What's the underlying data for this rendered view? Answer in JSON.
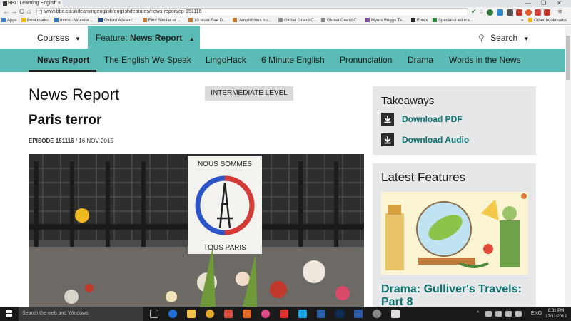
{
  "browser": {
    "tab_title": "BBC Learning English",
    "tab_close": "×",
    "url": "www.bbc.co.uk/learningenglish/english/features/news-report/ep-151116",
    "win_controls": [
      "—",
      "❐",
      "✕"
    ],
    "nav": {
      "back": "←",
      "forward": "→",
      "reload": "C",
      "home": "⌂"
    },
    "star": "☆",
    "menu": "≡",
    "bookmarks": [
      "Apps",
      "Bookmarks",
      "Inbox - Wunder...",
      "Oxford Advanc...",
      "Find Similar or ...",
      "10 Must-See D...",
      "'Amphibious ho...",
      "Global Grand C...",
      "Global Grand C...",
      "Myers Briggs Te...",
      "Forex",
      "Specialist educa...",
      "»",
      "Other bookmarks"
    ]
  },
  "site": {
    "courses_label": "Courses",
    "courses_caret": "▼",
    "feature_prefix": "Feature: ",
    "feature_name": "News Report",
    "feature_caret": "▲",
    "search_icon": "⚲",
    "search_label": "Search",
    "search_caret": "▼",
    "subnav": [
      "News Report",
      "The English We Speak",
      "LingoHack",
      "6 Minute English",
      "Pronunciation",
      "Drama",
      "Words in the News"
    ]
  },
  "article": {
    "section_title": "News Report",
    "level_badge": "INTERMEDIATE LEVEL",
    "title": "Paris terror",
    "episode_label": "EPISODE 151116",
    "date": " / 16 NOV 2015",
    "sign_top": "NOUS SOMMES",
    "sign_bottom": "TOUS PARIS"
  },
  "sidebar": {
    "takeaways_title": "Takeaways",
    "download_pdf": "Download PDF",
    "download_audio": "Download Audio",
    "latest_title": "Latest Features",
    "feature_title": "Drama: Gulliver's Travels: Part 8"
  },
  "taskbar": {
    "search_placeholder": "Search the web and Windows",
    "language": "ENG",
    "time": "8:31 PM",
    "date": "17/11/2015"
  },
  "colors": {
    "teal": "#5bbcb6",
    "link": "#0d7370",
    "side_bg": "#e6e7e9"
  }
}
